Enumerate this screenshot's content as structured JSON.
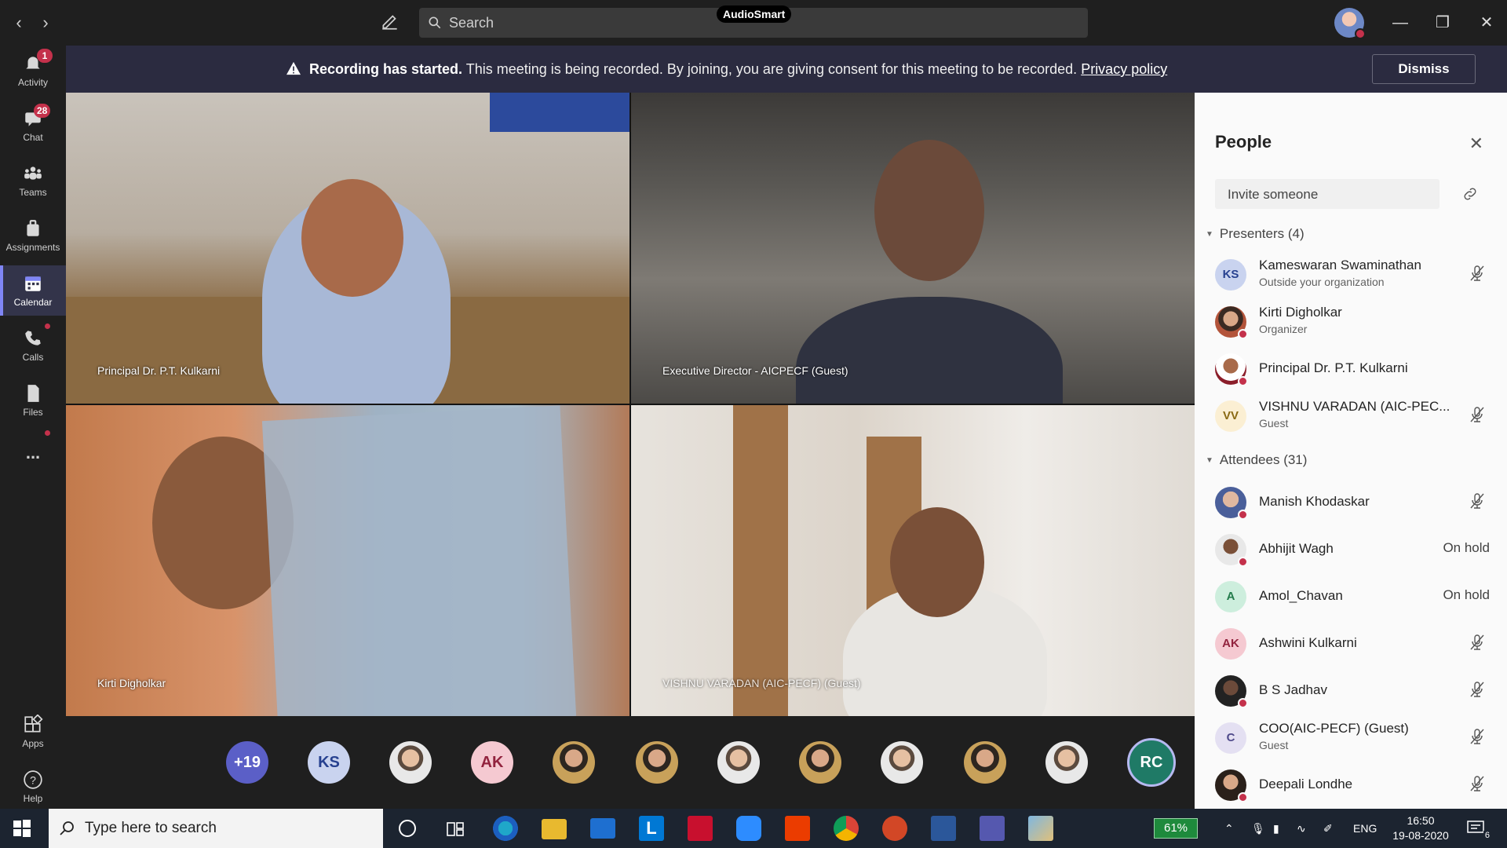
{
  "titlebar": {
    "search_placeholder": "Search",
    "overlay_label": "AudioSmart"
  },
  "rail": {
    "items": [
      {
        "label": "Activity",
        "badge": "1"
      },
      {
        "label": "Chat",
        "badge": "28"
      },
      {
        "label": "Teams"
      },
      {
        "label": "Assignments"
      },
      {
        "label": "Calendar",
        "active": true
      },
      {
        "label": "Calls"
      },
      {
        "label": "Files"
      },
      {
        "label": "..."
      }
    ],
    "bottom": [
      {
        "label": "Apps"
      },
      {
        "label": "Help"
      }
    ]
  },
  "banner": {
    "title": "Recording has started.",
    "text": "This meeting is being recorded. By joining, you are giving consent for this meeting to be recorded.",
    "link": "Privacy policy",
    "dismiss": "Dismiss"
  },
  "tiles": [
    {
      "name": "Principal Dr. P.T. Kulkarni"
    },
    {
      "name": "Executive Director - AICPECF (Guest)"
    },
    {
      "name": "Kirti Digholkar"
    },
    {
      "name": "VISHNU VARADAN (AIC-PECF) (Guest)"
    }
  ],
  "controls": {
    "timer": "--:--"
  },
  "strip": {
    "more": "+19",
    "initials": [
      "KS",
      "AK",
      "RC"
    ]
  },
  "people": {
    "title": "People",
    "invite_placeholder": "Invite someone",
    "presenters_header": "Presenters (4)",
    "attendees_header": "Attendees (31)",
    "presenters": [
      {
        "initials": "KS",
        "name": "Kameswaran Swaminathan",
        "sub": "Outside your organization"
      },
      {
        "initials": "",
        "name": "Kirti Digholkar",
        "sub": "Organizer"
      },
      {
        "initials": "",
        "name": "Principal Dr. P.T. Kulkarni",
        "sub": ""
      },
      {
        "initials": "VV",
        "name": "VISHNU VARADAN (AIC-PEC...",
        "sub": "Guest"
      }
    ],
    "attendees": [
      {
        "initials": "",
        "name": "Manish Khodaskar",
        "status": ""
      },
      {
        "initials": "",
        "name": "Abhijit Wagh",
        "status": "On hold"
      },
      {
        "initials": "A",
        "name": "Amol_Chavan",
        "status": "On hold"
      },
      {
        "initials": "AK",
        "name": "Ashwini Kulkarni",
        "status": ""
      },
      {
        "initials": "",
        "name": "B S Jadhav",
        "status": ""
      },
      {
        "initials": "C",
        "name": "COO(AIC-PECF) (Guest)",
        "sub": "Guest",
        "status": ""
      },
      {
        "initials": "",
        "name": "Deepali Londhe",
        "status": ""
      }
    ]
  },
  "taskbar": {
    "search_placeholder": "Type here to search",
    "battery": "61%",
    "lang": "ENG",
    "time": "16:50",
    "date": "19-08-2020",
    "notifications": "6"
  }
}
